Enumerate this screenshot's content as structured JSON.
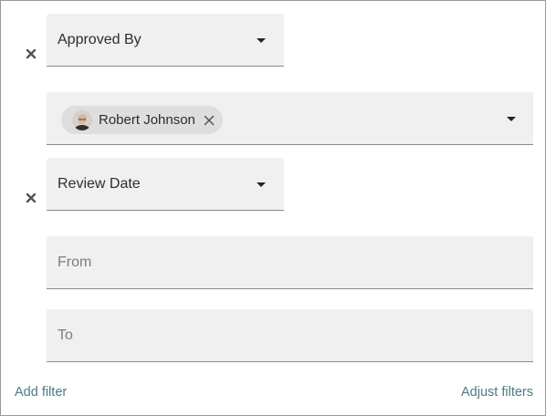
{
  "filters": [
    {
      "field_label": "Approved By",
      "value": {
        "chips": [
          {
            "label": "Robert Johnson",
            "avatar": "person-avatar"
          }
        ]
      }
    },
    {
      "field_label": "Review Date",
      "range": {
        "from_placeholder": "From",
        "to_placeholder": "To"
      }
    }
  ],
  "footer": {
    "add_filter": "Add filter",
    "adjust_filters": "Adjust filters"
  },
  "icons": {
    "remove_filter": "close-icon",
    "dropdown": "caret-down-icon",
    "chip_remove": "close-icon"
  },
  "colors": {
    "link": "#4a7b80",
    "field_bg": "#f0f0f0",
    "chip_bg": "#dedede"
  }
}
